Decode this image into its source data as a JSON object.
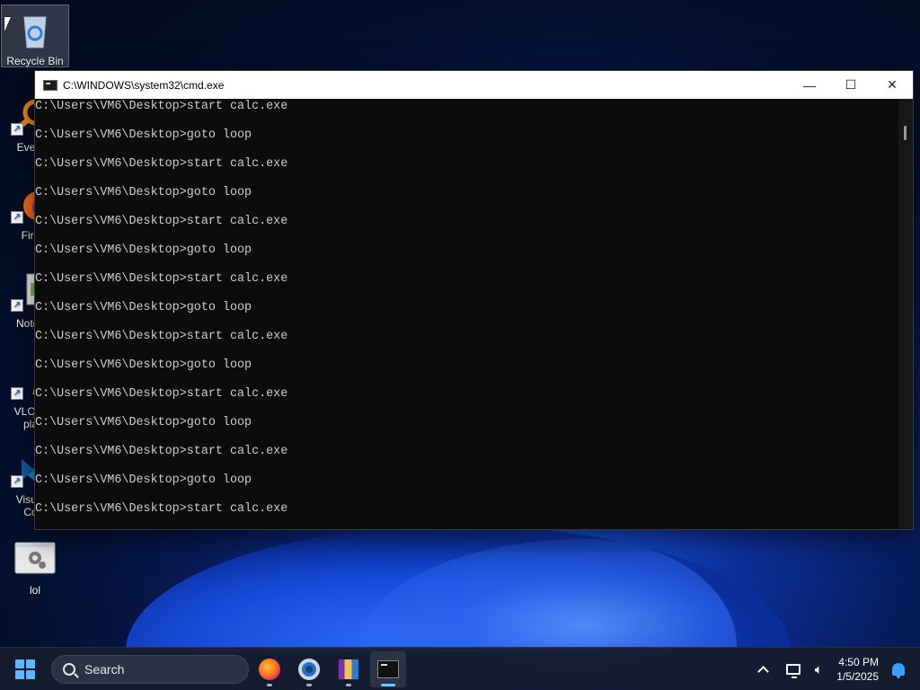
{
  "desktop": {
    "icons": [
      {
        "label": "Recycle Bin",
        "icon": "recycle-bin-icon"
      },
      {
        "label": "Every",
        "icon": "everything-icon"
      },
      {
        "label": "Fire",
        "icon": "firefox-icon"
      },
      {
        "label": "Notep",
        "icon": "notepad-icon"
      },
      {
        "label": "VLC m",
        "label2": "pla",
        "icon": "vlc-icon"
      },
      {
        "label": "Visual",
        "label2": "Co",
        "icon": "vscode-icon"
      },
      {
        "label": "lol",
        "icon": "batch-file-icon"
      }
    ]
  },
  "cmd": {
    "title": "C:\\WINDOWS\\system32\\cmd.exe",
    "lines": [
      "C:\\Users\\VM6\\Desktop>start calc.exe",
      "C:\\Users\\VM6\\Desktop>goto loop",
      "C:\\Users\\VM6\\Desktop>start calc.exe",
      "C:\\Users\\VM6\\Desktop>goto loop",
      "C:\\Users\\VM6\\Desktop>start calc.exe",
      "C:\\Users\\VM6\\Desktop>goto loop",
      "C:\\Users\\VM6\\Desktop>start calc.exe",
      "C:\\Users\\VM6\\Desktop>goto loop",
      "C:\\Users\\VM6\\Desktop>start calc.exe",
      "C:\\Users\\VM6\\Desktop>goto loop",
      "C:\\Users\\VM6\\Desktop>start calc.exe",
      "C:\\Users\\VM6\\Desktop>goto loop",
      "C:\\Users\\VM6\\Desktop>start calc.exe",
      "C:\\Users\\VM6\\Desktop>goto loop",
      "C:\\Users\\VM6\\Desktop>start calc.exe"
    ],
    "controls": {
      "minimize": "—",
      "maximize": "☐",
      "close": "✕"
    }
  },
  "taskbar": {
    "search_placeholder": "Search",
    "apps": [
      "firefox-icon",
      "settings-icon",
      "winrar-icon",
      "cmd-icon"
    ],
    "active_app": "cmd-icon",
    "tray": {
      "time": "4:50 PM",
      "date": "1/5/2025"
    }
  }
}
